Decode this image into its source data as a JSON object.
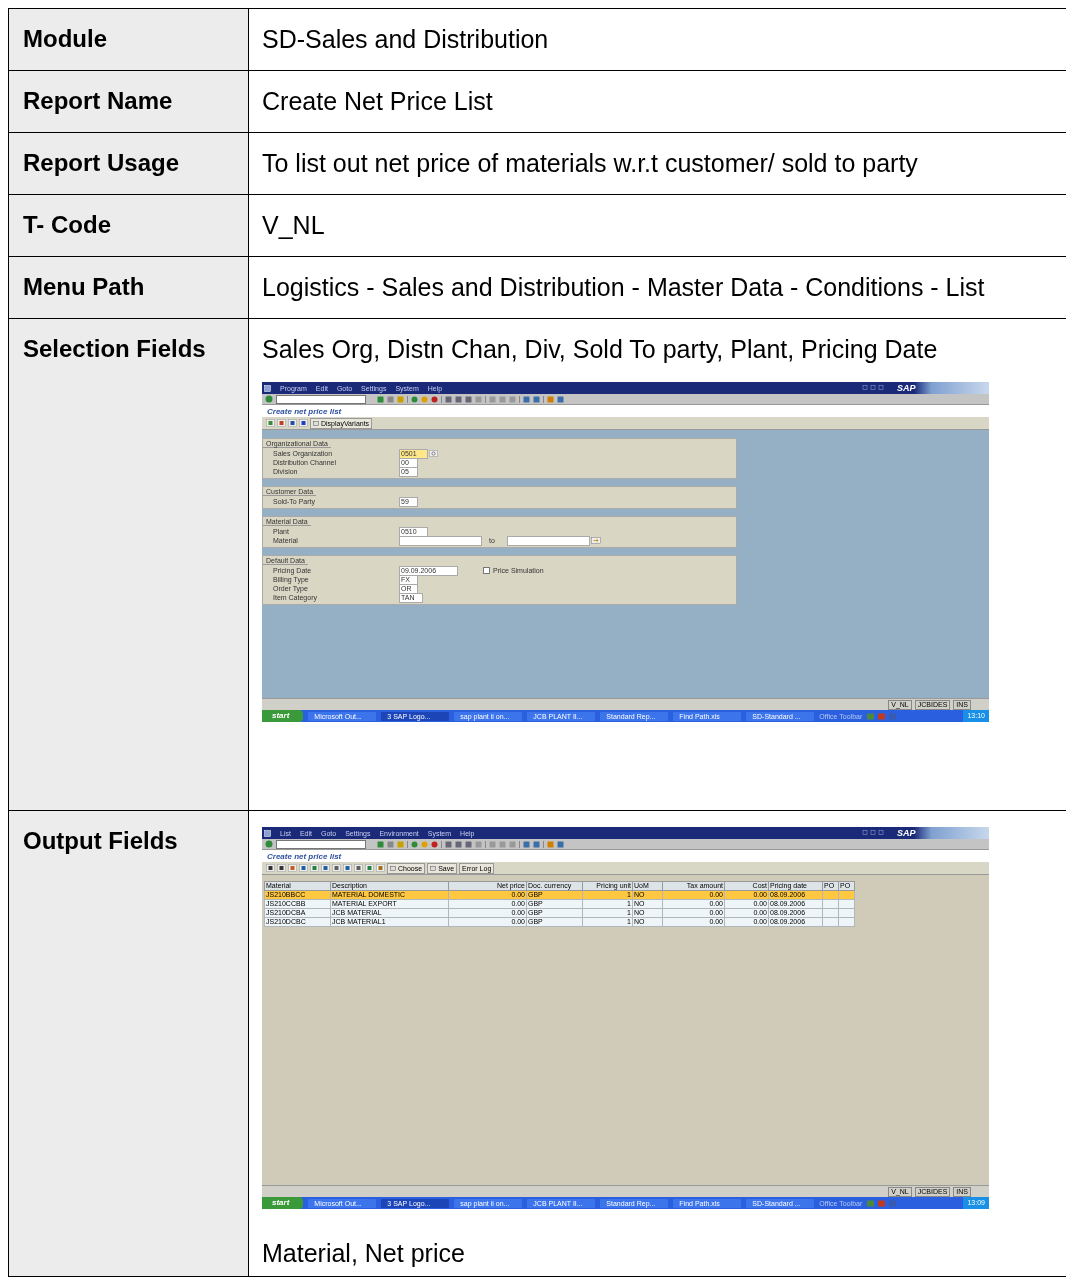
{
  "rows": [
    {
      "label": "Module",
      "content": [
        {
          "kind": "text",
          "text": "SD-Sales and Distribution"
        }
      ]
    },
    {
      "label": "Report Name",
      "content": [
        {
          "kind": "text",
          "text": "Create Net Price List"
        }
      ]
    },
    {
      "label": "Report Usage",
      "content": [
        {
          "kind": "text",
          "text": "To list out net price of materials w.r.t customer/ sold to party"
        }
      ]
    },
    {
      "label": "T- Code",
      "content": [
        {
          "kind": "text",
          "text": "V_NL"
        }
      ]
    },
    {
      "label": "Menu Path",
      "content": [
        {
          "kind": "text",
          "text": "Logistics - Sales and Distribution - Master Data - Conditions - List"
        }
      ]
    },
    {
      "label": "Selection Fields",
      "content": [
        {
          "kind": "text",
          "text": "Sales Org, Distn Chan, Div, Sold To party, Plant, Pricing Date"
        },
        {
          "kind": "selection_window",
          "menu": [
            "Program",
            "Edit",
            "Goto",
            "Settings",
            "System",
            "Help"
          ],
          "logo": "SAP",
          "title": "Create net price list",
          "app_toolbar": [
            {
              "label": "DisplayVariants",
              "kind": "icon_button"
            }
          ],
          "groups": [
            {
              "title": "Organizational Data",
              "fields": [
                {
                  "kind": "help",
                  "label": "Sales Organization",
                  "value": "0501",
                  "focused": true
                },
                {
                  "kind": "plain",
                  "label": "Distribution Channel",
                  "value": "00",
                  "focused": false
                },
                {
                  "kind": "plain",
                  "label": "Division",
                  "value": "05",
                  "focused": false
                }
              ]
            },
            {
              "title": "Customer Data",
              "fields": [
                {
                  "kind": "plain",
                  "label": "Sold-To Party",
                  "value": "59",
                  "focused": false
                }
              ]
            },
            {
              "title": "Material Data",
              "fields": [
                {
                  "kind": "plain",
                  "label": "Plant",
                  "value": "0510",
                  "focused": false
                },
                {
                  "kind": "range",
                  "label": "Material",
                  "focused": false,
                  "range_label": "to"
                }
              ]
            },
            {
              "title": "Default Data",
              "fields": [
                {
                  "kind": "plain",
                  "label": "Pricing Date",
                  "value": "09.09.2006",
                  "focused": false,
                  "checkbox": {
                    "label": "Price Simulation",
                    "checked": false
                  }
                },
                {
                  "kind": "plain",
                  "label": "Billing Type",
                  "value": "FX",
                  "focused": false
                },
                {
                  "kind": "plain",
                  "label": "Order Type",
                  "value": "OR",
                  "focused": false
                },
                {
                  "kind": "plain",
                  "label": "Item Category",
                  "value": "TAN",
                  "focused": false
                }
              ]
            }
          ],
          "status": [
            "V_NL",
            "JCBIDES",
            "INS"
          ],
          "taskbar": {
            "start": "start",
            "tasks": [
              {
                "label": "Microsoft Out...",
                "active": false
              },
              {
                "label": "3 SAP Logo...",
                "active": true
              },
              {
                "label": "sap plant ii on...",
                "active": false
              },
              {
                "label": "JCB PLANT II...",
                "active": false
              },
              {
                "label": "Standard Rep...",
                "active": false
              },
              {
                "label": "Find Path.xls",
                "active": false
              },
              {
                "label": "SD-Standard ...",
                "active": false
              }
            ],
            "toolbar": "Office Toolbar",
            "clock": "13:10"
          }
        }
      ]
    },
    {
      "label": "Output Fields",
      "content": [
        {
          "kind": "list_window",
          "menu": [
            "List",
            "Edit",
            "Goto",
            "Settings",
            "Environment",
            "System",
            "Help"
          ],
          "logo": "SAP",
          "title": "Create net price list",
          "app_toolbar": [
            {
              "label": "Choose",
              "kind": "icon_button"
            },
            {
              "label": "Save",
              "kind": "icon_button"
            },
            {
              "label": "Error Log",
              "kind": "text_button"
            }
          ],
          "grid": {
            "columns": [
              {
                "label": "Material",
                "kind": "text"
              },
              {
                "label": "Description",
                "kind": "text"
              },
              {
                "label": "Net price",
                "kind": "number"
              },
              {
                "label": "Doc. currency",
                "kind": "text"
              },
              {
                "label": "Pricing unit",
                "kind": "number"
              },
              {
                "label": "UoM",
                "kind": "text"
              },
              {
                "label": "Tax amount",
                "kind": "number"
              },
              {
                "label": "Cost",
                "kind": "number"
              },
              {
                "label": "Pricing date",
                "kind": "text"
              },
              {
                "label": "PO",
                "kind": "text"
              },
              {
                "label": "PO",
                "kind": "text"
              }
            ],
            "rows": [
              {
                "cells": [
                  "JS210BBCC",
                  "MATERIAL DOMESTIC",
                  "0.00",
                  "GBP",
                  "1",
                  "NO",
                  "0.00",
                  "0.00",
                  "08.09.2006",
                  "",
                  ""
                ],
                "selected": true
              },
              {
                "cells": [
                  "JS210CCBB",
                  "MATERIAL EXPORT",
                  "0.00",
                  "GBP",
                  "1",
                  "NO",
                  "0.00",
                  "0.00",
                  "08.09.2006",
                  "",
                  ""
                ],
                "selected": false
              },
              {
                "cells": [
                  "JS210DCBA",
                  "JCB MATERIAL",
                  "0.00",
                  "GBP",
                  "1",
                  "NO",
                  "0.00",
                  "0.00",
                  "08.09.2006",
                  "",
                  ""
                ],
                "selected": false
              },
              {
                "cells": [
                  "JS210DCBC",
                  "JCB MATERIAL1",
                  "0.00",
                  "GBP",
                  "1",
                  "NO",
                  "0.00",
                  "0.00",
                  "08.09.2006",
                  "",
                  ""
                ],
                "selected": false
              }
            ]
          },
          "status": [
            "V_NL",
            "JCBIDES",
            "INS"
          ],
          "taskbar": {
            "start": "start",
            "tasks": [
              {
                "label": "Microsoft Out...",
                "active": false
              },
              {
                "label": "3 SAP Logo...",
                "active": true
              },
              {
                "label": "sap plant ii on...",
                "active": false
              },
              {
                "label": "JCB PLANT II...",
                "active": false
              },
              {
                "label": "Standard Rep...",
                "active": false
              },
              {
                "label": "Find Path.xls",
                "active": false
              },
              {
                "label": "SD-Standard ...",
                "active": false
              }
            ],
            "toolbar": "Office Toolbar",
            "clock": "13:09"
          }
        },
        {
          "kind": "text",
          "text": "Material, Net price"
        }
      ]
    }
  ]
}
